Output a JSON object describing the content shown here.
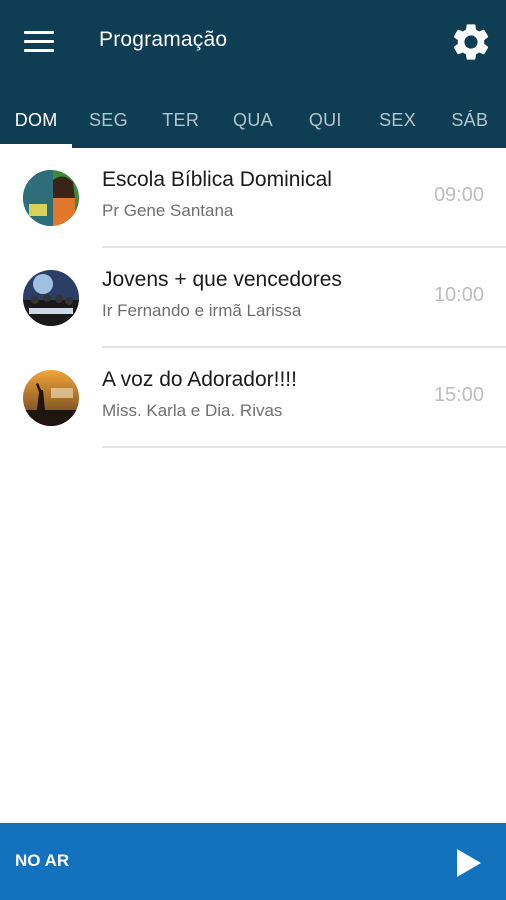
{
  "header": {
    "title": "Programação",
    "menu_icon": "menu-icon",
    "settings_icon": "gear-icon",
    "background_color": "#0f3d54"
  },
  "tabs": [
    {
      "label": "DOM",
      "active": true
    },
    {
      "label": "SEG",
      "active": false
    },
    {
      "label": "TER",
      "active": false
    },
    {
      "label": "QUA",
      "active": false
    },
    {
      "label": "QUI",
      "active": false
    },
    {
      "label": "SEX",
      "active": false
    },
    {
      "label": "SÁB",
      "active": false
    }
  ],
  "schedule": [
    {
      "title": "Escola Bíblica Dominical",
      "host": "Pr Gene Santana",
      "time": "09:00",
      "thumbnail_icon": "program-thumbnail-icon"
    },
    {
      "title": "Jovens + que vencedores",
      "host": "Ir Fernando e irmã Larissa",
      "time": "10:00",
      "thumbnail_icon": "program-thumbnail-icon"
    },
    {
      "title": "A voz do Adorador!!!!",
      "host": "Miss. Karla e Dia. Rivas",
      "time": "15:00",
      "thumbnail_icon": "program-thumbnail-icon"
    }
  ],
  "player": {
    "label": "NO AR",
    "play_icon": "play-icon",
    "background_color": "#1272bd"
  }
}
